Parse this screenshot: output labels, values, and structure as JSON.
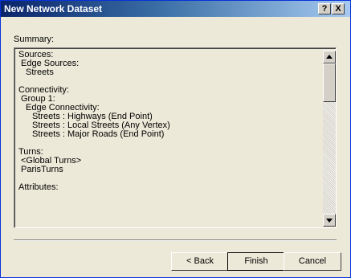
{
  "window": {
    "title": "New Network Dataset",
    "help_button": "?",
    "close_button": "X"
  },
  "summary": {
    "label": "Summary:",
    "lines": [
      {
        "text": "Sources:",
        "indent": 1
      },
      {
        "text": "Edge Sources:",
        "indent": 2
      },
      {
        "text": "Streets",
        "indent": 3
      },
      {
        "text": "",
        "indent": 0
      },
      {
        "text": "Connectivity:",
        "indent": 1
      },
      {
        "text": "Group 1:",
        "indent": 2
      },
      {
        "text": "Edge Connectivity:",
        "indent": 3
      },
      {
        "text": "Streets : Highways (End Point)",
        "indent": 4
      },
      {
        "text": "Streets : Local Streets (Any Vertex)",
        "indent": 4
      },
      {
        "text": "Streets : Major Roads (End Point)",
        "indent": 4
      },
      {
        "text": "",
        "indent": 0
      },
      {
        "text": "Turns:",
        "indent": 1
      },
      {
        "text": "<Global Turns>",
        "indent": 2
      },
      {
        "text": "ParisTurns",
        "indent": 2
      },
      {
        "text": "",
        "indent": 0
      },
      {
        "text": "Attributes:",
        "indent": 1
      }
    ]
  },
  "buttons": {
    "back": "< Back",
    "finish": "Finish",
    "cancel": "Cancel"
  }
}
